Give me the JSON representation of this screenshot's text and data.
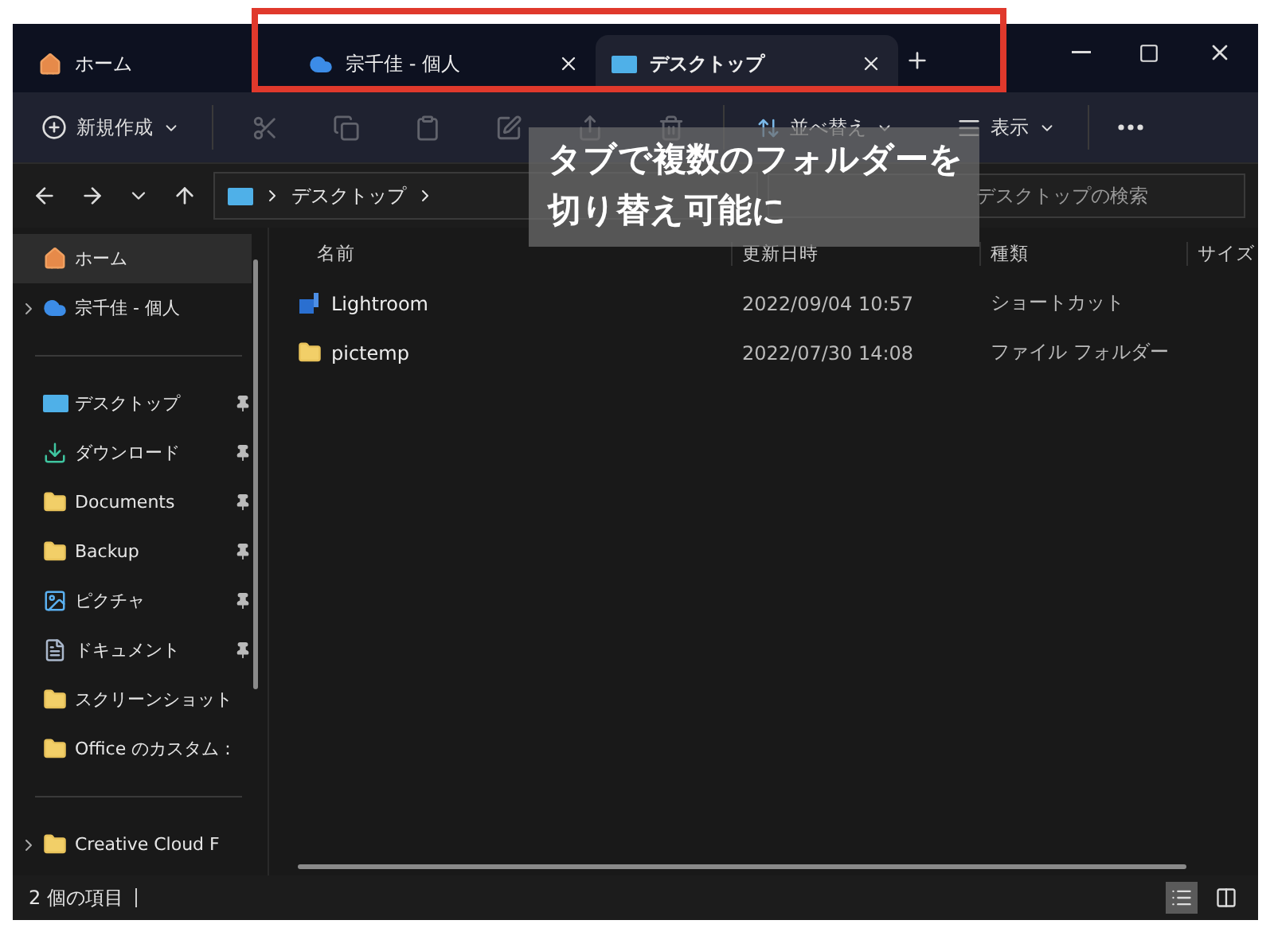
{
  "tabs": [
    {
      "label": "ホーム",
      "kind": "home",
      "selected": false
    },
    {
      "label": "宗千佳 - 個人",
      "kind": "cloud",
      "selected": false
    },
    {
      "label": "デスクトップ",
      "kind": "desktop",
      "selected": true
    }
  ],
  "toolbar": {
    "new_label": "新規作成",
    "actions": [
      {
        "kind": "cut",
        "disabled": true
      },
      {
        "kind": "copy",
        "disabled": true
      },
      {
        "kind": "paste",
        "disabled": true
      },
      {
        "kind": "rename",
        "disabled": true
      },
      {
        "kind": "share",
        "disabled": true
      },
      {
        "kind": "delete",
        "disabled": true
      }
    ],
    "sort_label": "並べ替え",
    "view_label": "表示"
  },
  "address": {
    "path": [
      "デスクトップ"
    ],
    "search": {
      "placeholder": "デスクトップの検索"
    }
  },
  "sidebar": {
    "sections": [
      {
        "items": [
          {
            "label": "ホーム",
            "kind": "home",
            "selected": true,
            "expandable": false,
            "pinned": false
          },
          {
            "label": "宗千佳 - 個人",
            "kind": "cloud",
            "selected": false,
            "expandable": true,
            "pinned": false
          }
        ]
      },
      {
        "items": [
          {
            "label": "デスクトップ",
            "kind": "desktop",
            "selected": false,
            "expandable": false,
            "pinned": true
          },
          {
            "label": "ダウンロード",
            "kind": "download",
            "selected": false,
            "expandable": false,
            "pinned": true
          },
          {
            "label": "Documents",
            "kind": "folder",
            "selected": false,
            "expandable": false,
            "pinned": true
          },
          {
            "label": "Backup",
            "kind": "folder",
            "selected": false,
            "expandable": false,
            "pinned": true
          },
          {
            "label": "ピクチャ",
            "kind": "pictures",
            "selected": false,
            "expandable": false,
            "pinned": true
          },
          {
            "label": "ドキュメント",
            "kind": "document",
            "selected": false,
            "expandable": false,
            "pinned": true
          },
          {
            "label": "スクリーンショット",
            "kind": "folder",
            "selected": false,
            "expandable": false,
            "pinned": false
          },
          {
            "label": "Office のカスタム :",
            "kind": "folder",
            "selected": false,
            "expandable": false,
            "pinned": false
          }
        ]
      },
      {
        "items": [
          {
            "label": "Creative Cloud F",
            "kind": "cc-folder",
            "selected": false,
            "expandable": true,
            "pinned": false
          }
        ]
      }
    ]
  },
  "table": {
    "columns": [
      "名前",
      "更新日時",
      "種類",
      "サイズ"
    ],
    "rows": [
      {
        "kind": "shortcut",
        "name": "Lightroom",
        "modified": "2022/09/04 10:57",
        "type": "ショートカット"
      },
      {
        "kind": "folder",
        "name": "pictemp",
        "modified": "2022/07/30 14:08",
        "type": "ファイル フォルダー"
      }
    ]
  },
  "status_bar": {
    "count": "2 個の項目",
    "views": [
      {
        "kind": "details",
        "selected": true
      },
      {
        "kind": "tiles",
        "selected": false
      }
    ]
  },
  "annotation": {
    "lines": [
      "タブで複数のフォルダーを",
      "切り替え可能に"
    ]
  }
}
